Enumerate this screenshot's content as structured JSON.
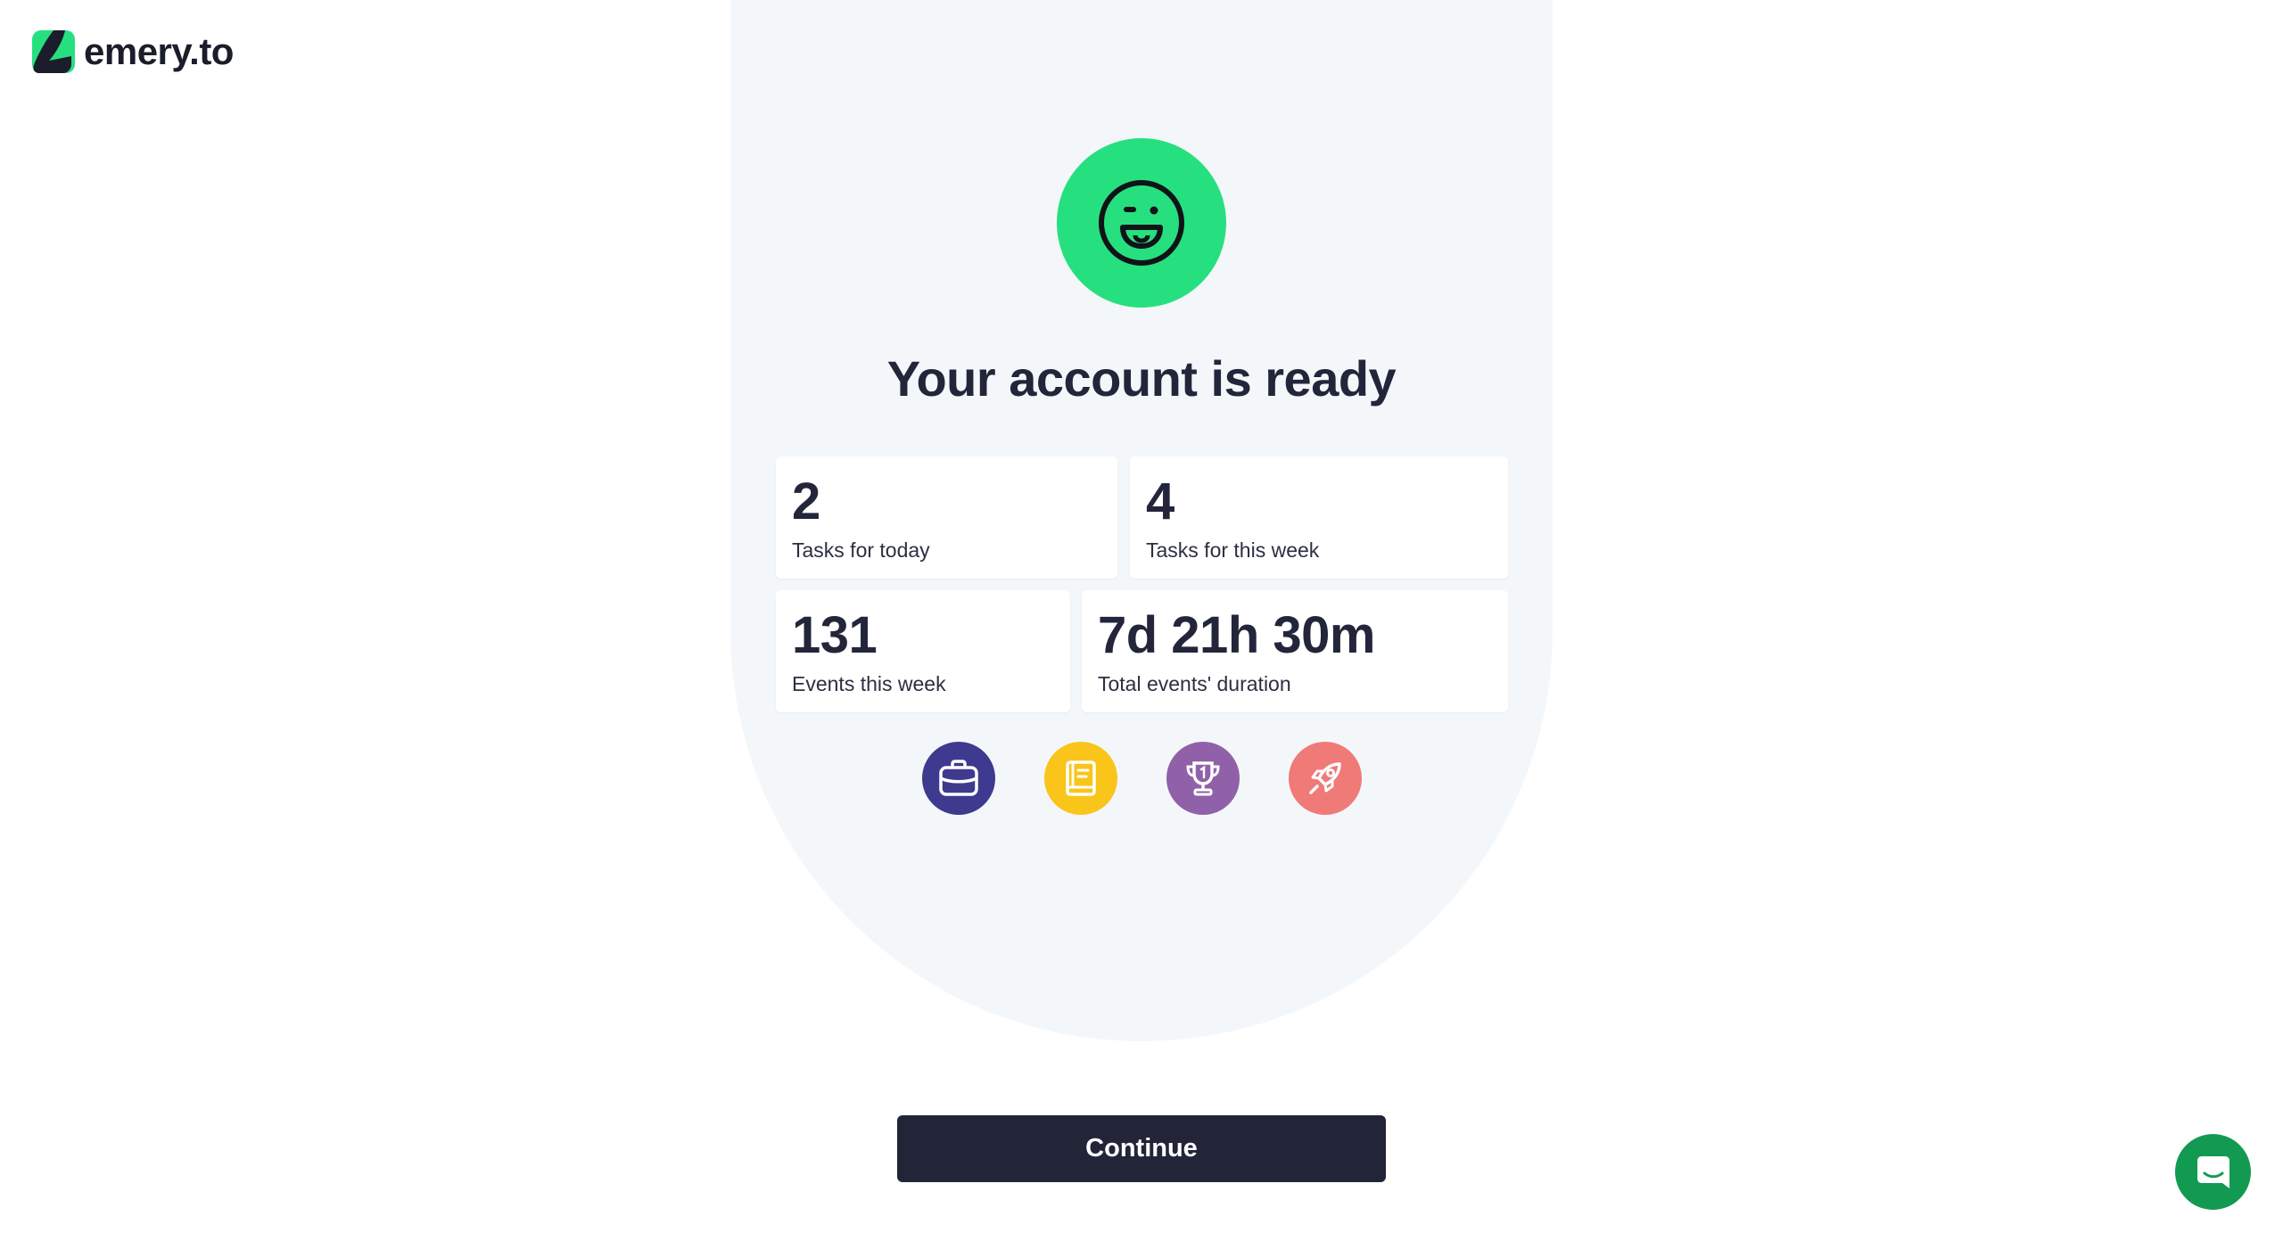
{
  "brand": {
    "name": "emery.to",
    "logo_icon": "emery-logo-icon",
    "accent": "#26e07f"
  },
  "hero": {
    "icon": "smiley-tongue-icon",
    "title": "Your account is ready"
  },
  "stats": [
    {
      "value": "2",
      "label": "Tasks for today"
    },
    {
      "value": "4",
      "label": "Tasks for this week"
    },
    {
      "value": "131",
      "label": "Events this week"
    },
    {
      "value": "7d 21h 30m",
      "label": "Total events' duration"
    }
  ],
  "categories": [
    {
      "icon": "briefcase-icon",
      "color": "#3e3a8f"
    },
    {
      "icon": "book-icon",
      "color": "#f9c51b"
    },
    {
      "icon": "trophy-icon",
      "color": "#9061a9"
    },
    {
      "icon": "rocket-icon",
      "color": "#f07a78"
    }
  ],
  "actions": {
    "continue_label": "Continue"
  },
  "chat": {
    "icon": "chat-icon",
    "color": "#129a52"
  }
}
